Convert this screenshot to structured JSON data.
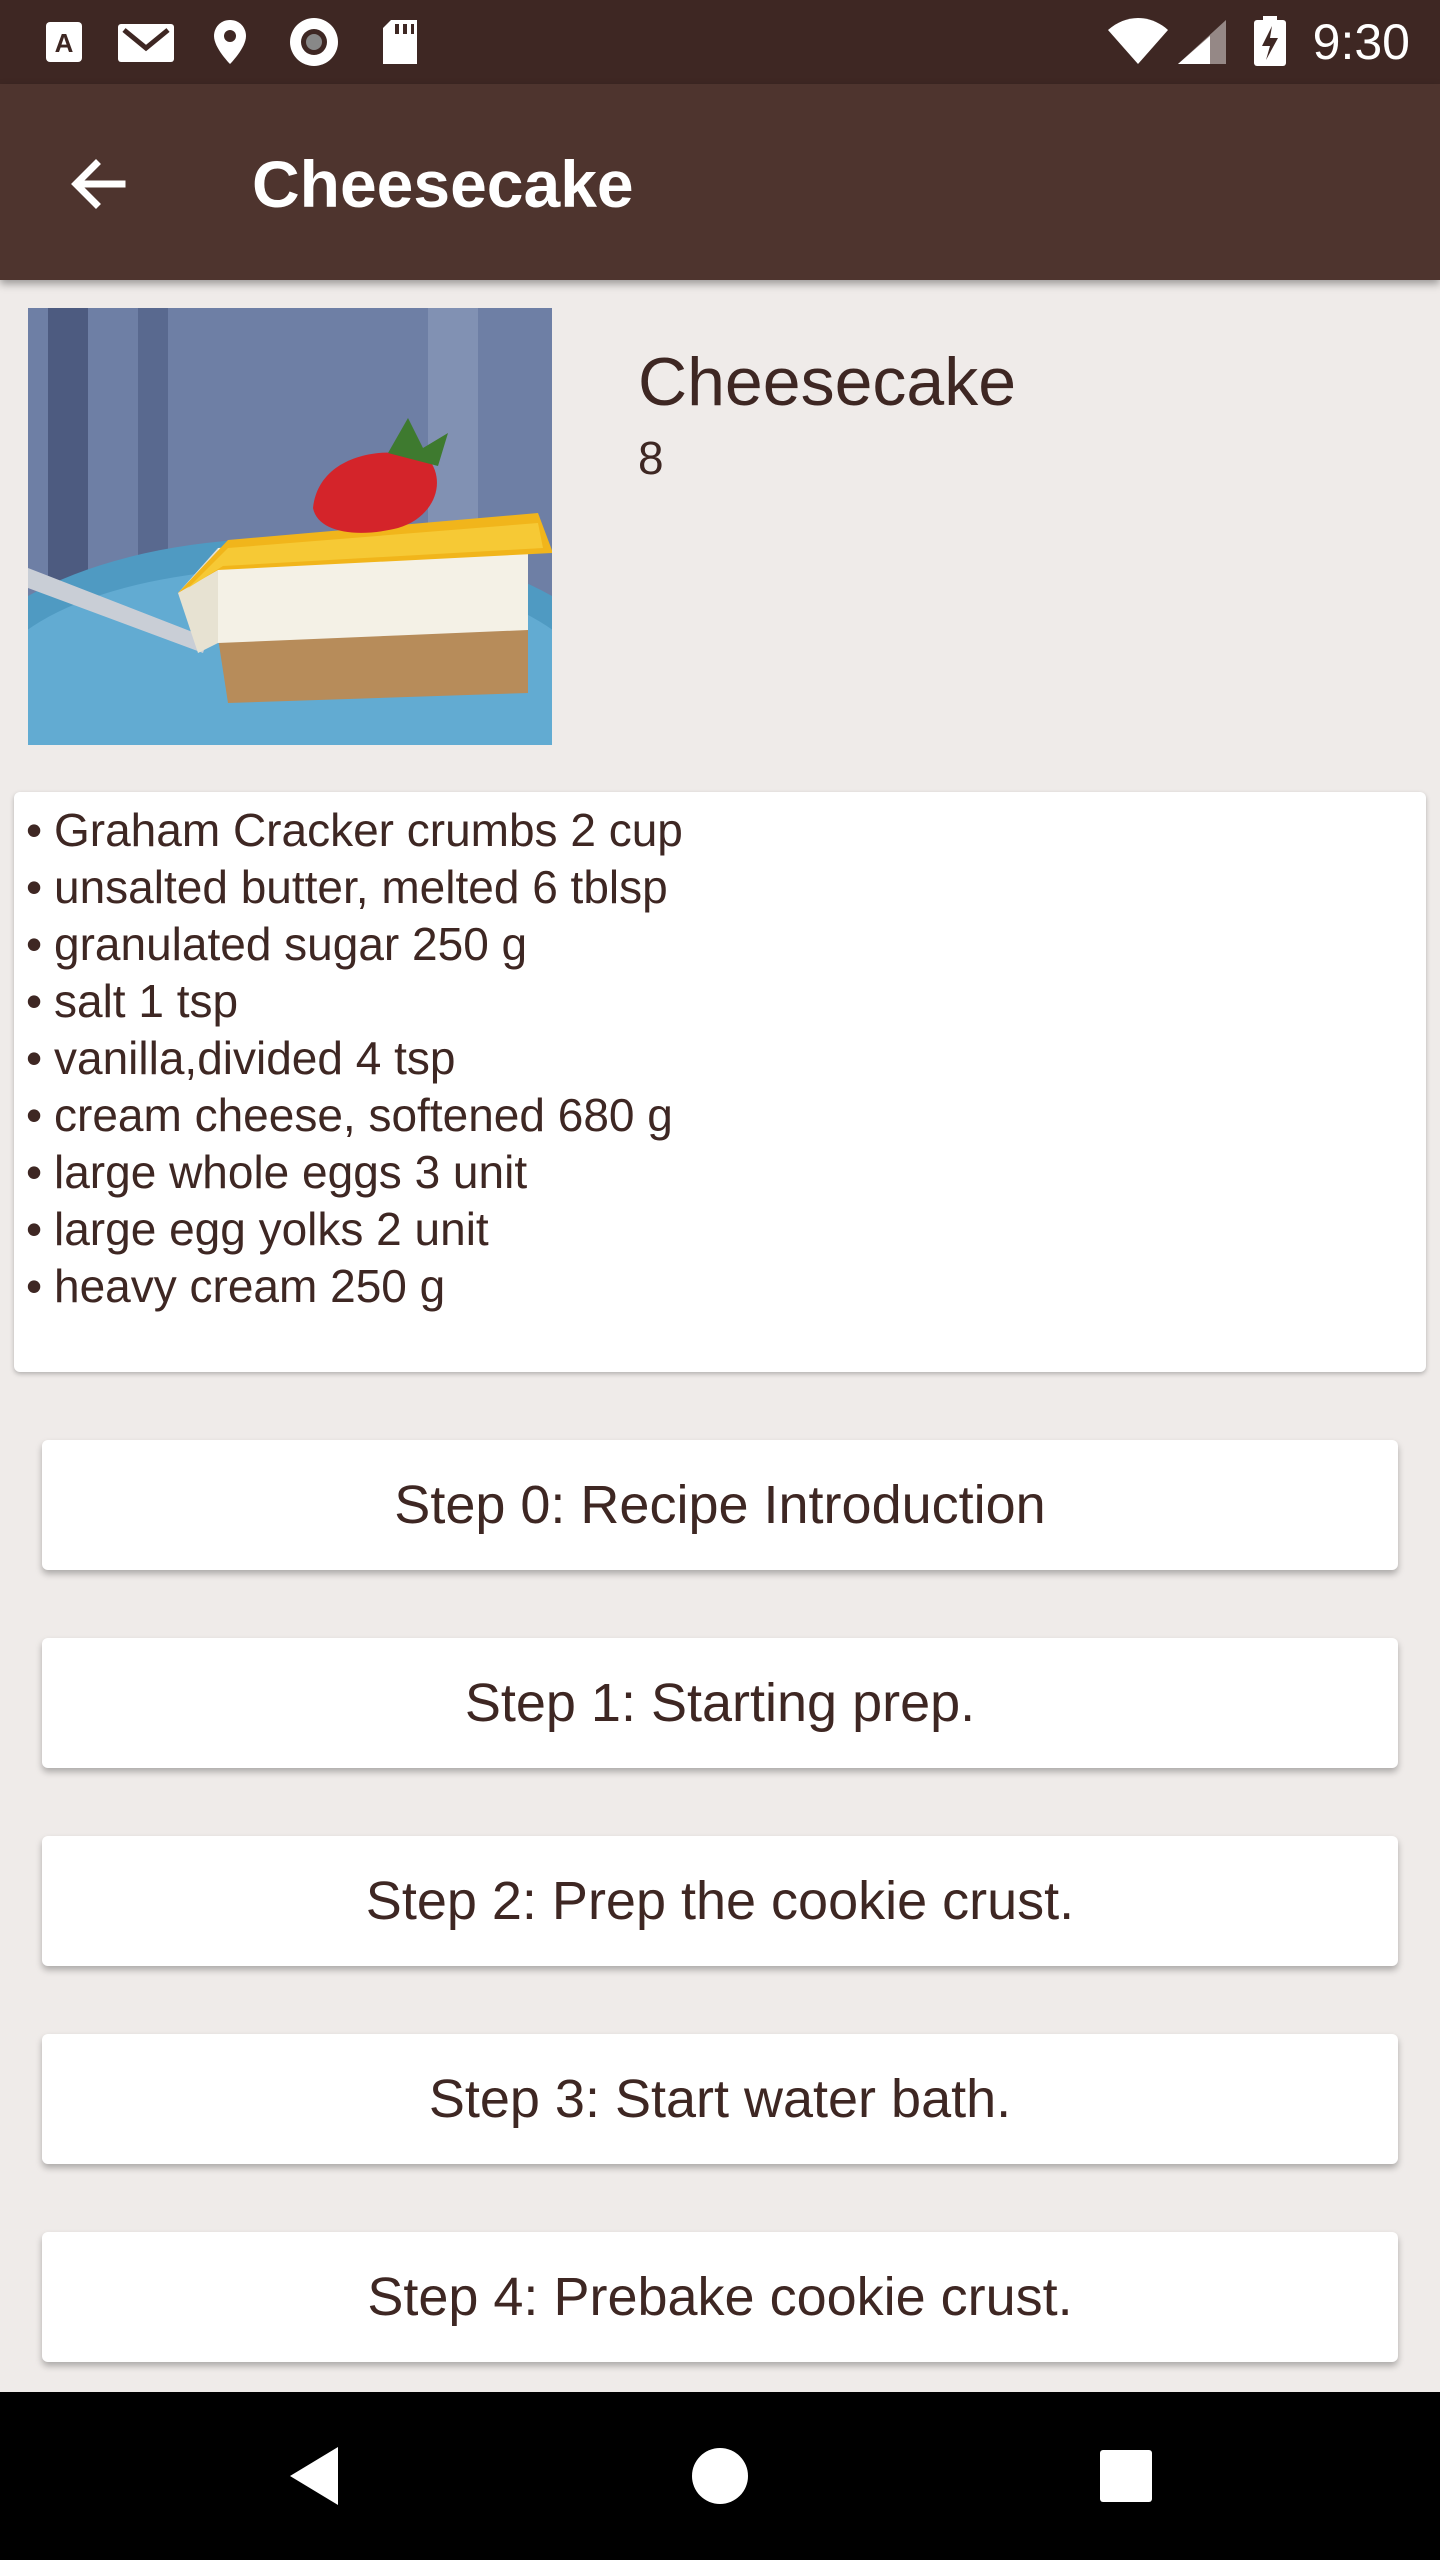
{
  "status_bar": {
    "time": "9:30",
    "left_icons": [
      "text-recognition-icon",
      "gmail-icon",
      "location-pin-icon",
      "record-icon",
      "sd-card-icon"
    ],
    "right_icons": [
      "wifi-icon",
      "cell-signal-icon",
      "battery-charging-icon"
    ]
  },
  "app_bar": {
    "title": "Cheesecake",
    "back_icon": "arrow-back-icon"
  },
  "recipe": {
    "name": "Cheesecake",
    "servings": "8",
    "image": "cheesecake-photo"
  },
  "ingredients": [
    "Graham Cracker crumbs  2 cup",
    "unsalted butter, melted  6 tblsp",
    "granulated sugar  250 g",
    "salt  1 tsp",
    "vanilla,divided  4 tsp",
    "cream cheese, softened  680 g",
    "large whole eggs  3 unit",
    "large egg yolks  2 unit",
    "heavy cream  250 g"
  ],
  "ingredient_bullet": "•",
  "steps": [
    "Step 0: Recipe Introduction",
    "Step 1: Starting prep.",
    "Step 2: Prep the cookie crust.",
    "Step 3: Start water bath.",
    "Step 4: Prebake cookie crust."
  ],
  "nav_bar": {
    "icons": [
      "nav-back-icon",
      "nav-home-icon",
      "nav-recents-icon"
    ]
  },
  "colors": {
    "primary": "#4E342E",
    "primary_dark": "#3E2723",
    "background": "#EFEBE9",
    "text": "#3E2723"
  }
}
